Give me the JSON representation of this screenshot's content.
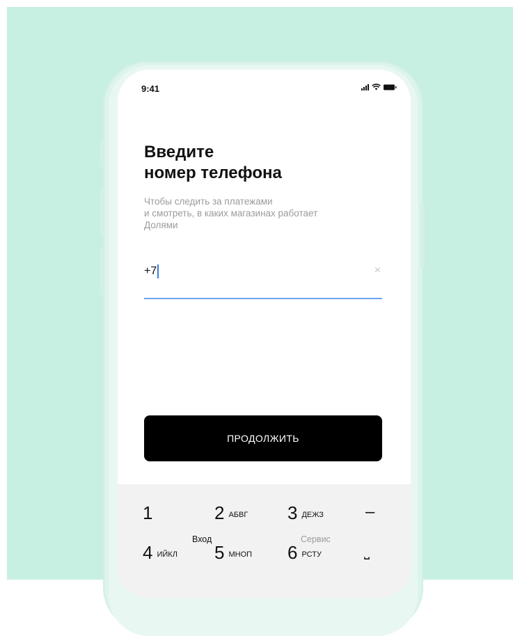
{
  "status_bar": {
    "time": "9:41"
  },
  "header": {
    "title_line1": "Введите",
    "title_line2": "номер телефона",
    "subtitle_line1": "Чтобы следить за платежами",
    "subtitle_line2": "и смотреть, в каких магазинах работает",
    "subtitle_line3": "Долями"
  },
  "phone_input": {
    "value": "+7",
    "clear_glyph": "×"
  },
  "continue_button": {
    "label": "ПРОДОЛЖИТЬ"
  },
  "keypad": {
    "k1": {
      "num": "1",
      "letters": ""
    },
    "k2": {
      "num": "2",
      "letters": "АБВГ"
    },
    "k3": {
      "num": "3",
      "letters": "ДЕЖЗ"
    },
    "minus": "–",
    "k4": {
      "num": "4",
      "letters": "ИЙКЛ"
    },
    "k5": {
      "num": "5",
      "letters": "МНОП"
    },
    "k6": {
      "num": "6",
      "letters": "РСТУ"
    },
    "space": "⎵"
  },
  "overlays": {
    "login": "Вход",
    "service": "Сервис"
  },
  "colors": {
    "background": "#c7f0e3",
    "accent": "#6aa4ec",
    "button": "#000000"
  }
}
